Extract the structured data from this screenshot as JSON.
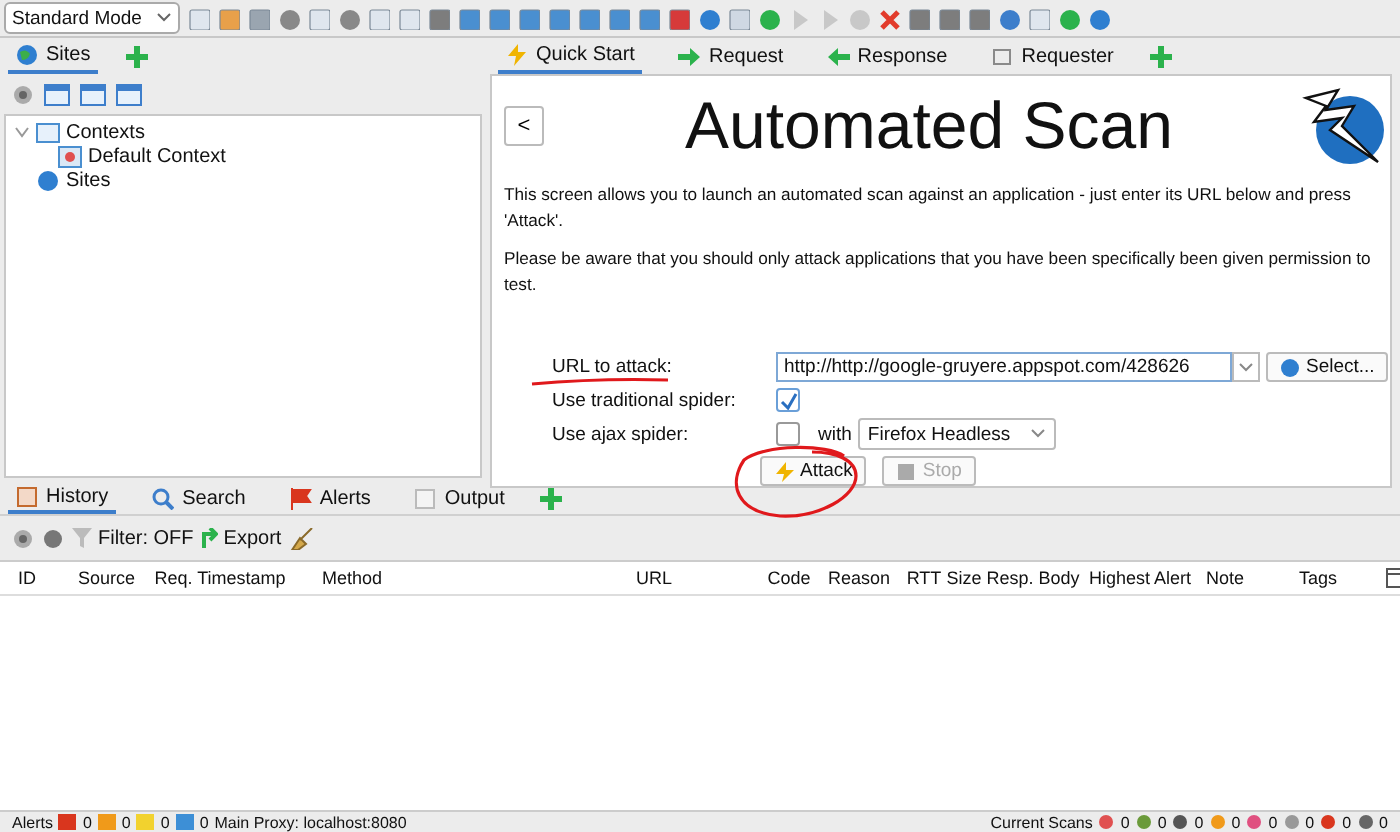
{
  "toolbar": {
    "mode": "Standard Mode"
  },
  "sites_panel": {
    "tab": {
      "label": "Sites",
      "selected": true
    },
    "tree": [
      {
        "label": "Contexts",
        "kind": "contexts",
        "expanded": true,
        "children": [
          {
            "label": "Default Context",
            "kind": "context"
          }
        ]
      },
      {
        "label": "Sites",
        "kind": "sites"
      }
    ]
  },
  "work_tabs": [
    {
      "label": "Quick Start",
      "kind": "quick",
      "selected": true
    },
    {
      "label": "Request",
      "kind": "request",
      "selected": false
    },
    {
      "label": "Response",
      "kind": "response",
      "selected": false
    },
    {
      "label": "Requester",
      "kind": "requester",
      "selected": false
    }
  ],
  "quick_start": {
    "back": "<",
    "title": "Automated Scan",
    "paragraphs": [
      "This screen allows you to launch an automated scan against  an application - just enter its URL below and press 'Attack'.",
      "Please be aware that you should only attack applications that you have been specifically been given permission to test."
    ],
    "url_label": "URL to attack:",
    "url_value": "http://http://google-gruyere.appspot.com/428626",
    "select_button": "Select...",
    "traditional_label": "Use traditional spider:",
    "traditional_checked": true,
    "ajax_label": "Use ajax spider:",
    "ajax_checked": false,
    "with_label": "with",
    "browser": "Firefox Headless",
    "attack_button": {
      "label": "Attack",
      "disabled": false
    },
    "stop_button": {
      "label": "Stop",
      "disabled": true
    }
  },
  "bottom_tabs": [
    {
      "label": "History",
      "kind": "history",
      "selected": true
    },
    {
      "label": "Search",
      "kind": "search",
      "selected": false
    },
    {
      "label": "Alerts",
      "kind": "alerts",
      "selected": false
    },
    {
      "label": "Output",
      "kind": "output",
      "selected": false
    }
  ],
  "history_toolbar": {
    "filter": "Filter: OFF",
    "export": "Export"
  },
  "table": {
    "columns": [
      "ID",
      "Source",
      "Req. Timestamp",
      "Method",
      "URL",
      "Code",
      "Reason",
      "RTT",
      "Size Resp. Body",
      "Highest Alert",
      "Note",
      "Tags"
    ]
  },
  "status_bar": {
    "alerts_label": "Alerts",
    "alert_counts": [
      {
        "count": "0",
        "color": "#d9361e"
      },
      {
        "count": "0",
        "color": "#f09a1a"
      },
      {
        "count": "0",
        "color": "#f2d22e"
      },
      {
        "count": "0",
        "color": "#3d8fd6"
      }
    ],
    "proxy": "Main Proxy: localhost:8080",
    "scans_label": "Current Scans",
    "scan_counts": [
      "0",
      "0",
      "0",
      "0",
      "0",
      "0",
      "0",
      "0"
    ]
  },
  "annotations": {
    "url_underlined": true,
    "attack_circled": true
  }
}
